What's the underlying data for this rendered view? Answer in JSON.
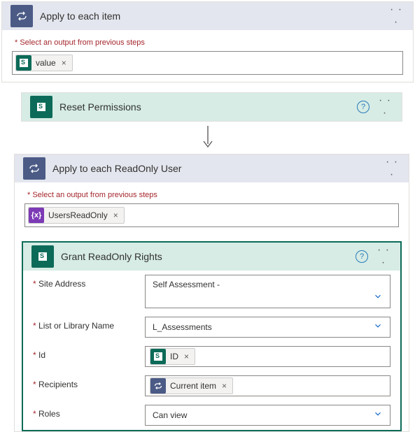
{
  "outer": {
    "title": "Apply to each item",
    "output_label": "Select an output from previous steps",
    "token": "value"
  },
  "reset": {
    "title": "Reset Permissions"
  },
  "inner": {
    "title": "Apply to each ReadOnly User",
    "output_label": "Select an output from previous steps",
    "token": "UsersReadOnly"
  },
  "grant": {
    "title": "Grant ReadOnly Rights",
    "fields": {
      "site_label": "Site Address",
      "site_value": "Self Assessment -",
      "list_label": "List or Library Name",
      "list_value": "L_Assessments",
      "id_label": "Id",
      "id_token": "ID",
      "recipients_label": "Recipients",
      "recipients_token": "Current item",
      "roles_label": "Roles",
      "roles_value": "Can view"
    }
  },
  "glyphs": {
    "fx": "{x}",
    "question": "?",
    "x": "×",
    "dots": "· · ·"
  }
}
